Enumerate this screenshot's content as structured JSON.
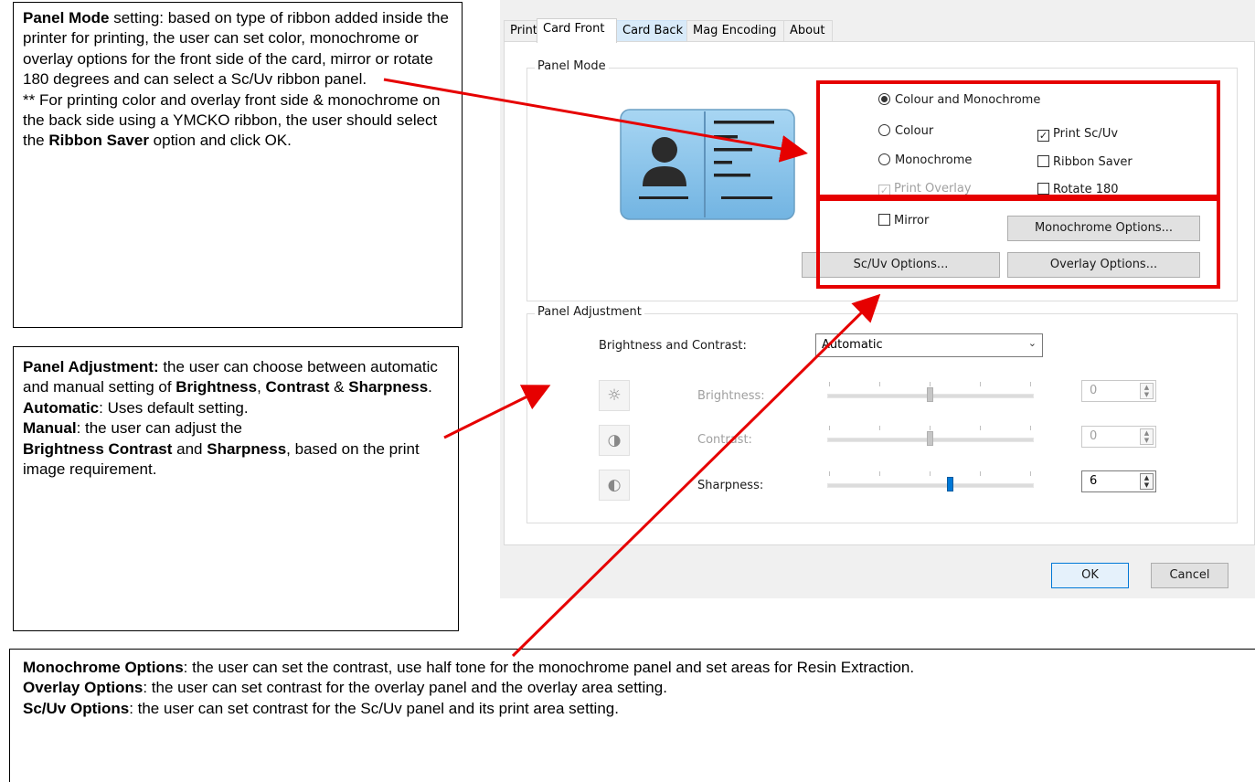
{
  "annotations": {
    "panel_mode": {
      "title": "Panel Mode",
      "text1": " setting: based on type of ribbon added inside the printer for printing, the user can set color, monochrome or overlay options for the front side of the card, mirror or rotate 180 degrees and can select a Sc/Uv ribbon panel.",
      "text2": "** For printing color and overlay front side & monochrome on the back side using a YMCKO ribbon, the user should select the ",
      "bold2": "Ribbon Saver",
      "text3": " option and click OK."
    },
    "panel_adjustment": {
      "title": "Panel Adjustment:",
      "t1": " the user can choose between automatic and manual setting of ",
      "b_brightness": "Brightness",
      "t2": ", ",
      "b_contrast": "Contrast",
      "t3": " & ",
      "b_sharpness": "Sharpness",
      "t4": ".",
      "b_automatic": "Automatic",
      "t5": ": Uses default setting.",
      "b_manual": "Manual",
      "t6": ": the user can adjust the ",
      "b_brightness_contrast": "Brightness Contrast",
      "t7": " and ",
      "b_sharpness2": "Sharpness",
      "t8": ", based on the print image requirement."
    },
    "options": {
      "mono_title": "Monochrome Options",
      "mono_text": ": the user can set the contrast, use half tone for the monochrome panel and set areas for Resin Extraction.",
      "overlay_title": "Overlay Options",
      "overlay_text": ": the user can set contrast for the overlay panel and the overlay area setting.",
      "scuv_title": "Sc/Uv Options",
      "scuv_text": ": the user can set contrast for the Sc/Uv panel and its print area setting."
    }
  },
  "dialog": {
    "tabs": [
      "Print",
      "Card Front",
      "Card Back",
      "Mag Encoding",
      "About"
    ],
    "active_tab": "Card Front",
    "panel_mode": {
      "title": "Panel Mode",
      "radio_colour_mono": "Colour and Monochrome",
      "radio_colour": "Colour",
      "radio_monochrome": "Monochrome",
      "print_overlay": "Print Overlay",
      "print_scuv": "Print Sc/Uv",
      "ribbon_saver": "Ribbon Saver",
      "rotate_180": "Rotate 180",
      "mirror": "Mirror",
      "check_mark": "✓",
      "selected_radio": "Colour and Monochrome",
      "print_scuv_checked": true,
      "print_overlay_checked": true,
      "ribbon_saver_checked": false,
      "rotate_180_checked": false,
      "mirror_checked": false
    },
    "buttons": {
      "monochrome_options": "Monochrome Options...",
      "scuv_options": "Sc/Uv Options...",
      "overlay_options": "Overlay Options...",
      "ok": "OK",
      "cancel": "Cancel"
    },
    "panel_adjustment": {
      "title": "Panel Adjustment",
      "bc_label": "Brightness and Contrast:",
      "bc_value": "Automatic",
      "brightness_label": "Brightness:",
      "brightness_value": "0",
      "brightness_level": 0.5,
      "contrast_label": "Contrast:",
      "contrast_value": "0",
      "contrast_level": 0.5,
      "sharpness_label": "Sharpness:",
      "sharpness_value": "6",
      "sharpness_level": 0.6
    },
    "colors": {
      "accent": "#0078d7",
      "card": "#8fc8ee",
      "highlight": "#e60000"
    }
  }
}
